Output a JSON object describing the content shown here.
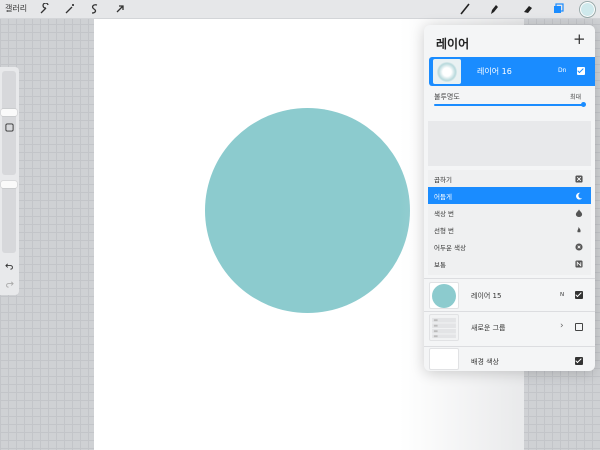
{
  "toolbar": {
    "gallery_label": "갤러리",
    "left_tools": [
      "wrench-icon",
      "magic-wand-icon",
      "selection-icon",
      "transform-arrow-icon"
    ],
    "right_tools": [
      "brush-icon",
      "smudge-icon",
      "eraser-icon",
      "layers-icon",
      "color-icon"
    ]
  },
  "canvas": {
    "background_color": "#ffffff",
    "circle_color": "#8ccbce"
  },
  "sidebar": {
    "controls": [
      "brush-size-slider",
      "modify-button",
      "opacity-slider",
      "undo-icon",
      "redo-icon"
    ]
  },
  "layers_panel": {
    "title": "레이어",
    "add_label": "+",
    "accent_color": "#1a8cff",
    "active_layer": {
      "name": "레이어 16",
      "blend_abbr": "Dn",
      "visible": true
    },
    "opacity": {
      "label": "불투명도",
      "value_label": "최대",
      "fraction": 1.0
    },
    "blend_modes": [
      {
        "label": "곱하기",
        "icon": "multiply-icon",
        "selected": false
      },
      {
        "label": "어둡게",
        "icon": "moon-icon",
        "selected": true
      },
      {
        "label": "색상 번",
        "icon": "flame-icon",
        "selected": false
      },
      {
        "label": "선형 번",
        "icon": "linear-burn-icon",
        "selected": false
      },
      {
        "label": "어두운 색상",
        "icon": "darker-color-icon",
        "selected": false
      },
      {
        "label": "보통",
        "icon": "normal-icon",
        "selected": false
      }
    ],
    "layers": [
      {
        "name": "레이어 15",
        "mode": "N",
        "visible": true,
        "type": "layer"
      },
      {
        "name": "새로운 그룹",
        "mode": "",
        "visible": false,
        "type": "group"
      },
      {
        "name": "배경 색상",
        "mode": "",
        "visible": true,
        "type": "background"
      }
    ]
  }
}
